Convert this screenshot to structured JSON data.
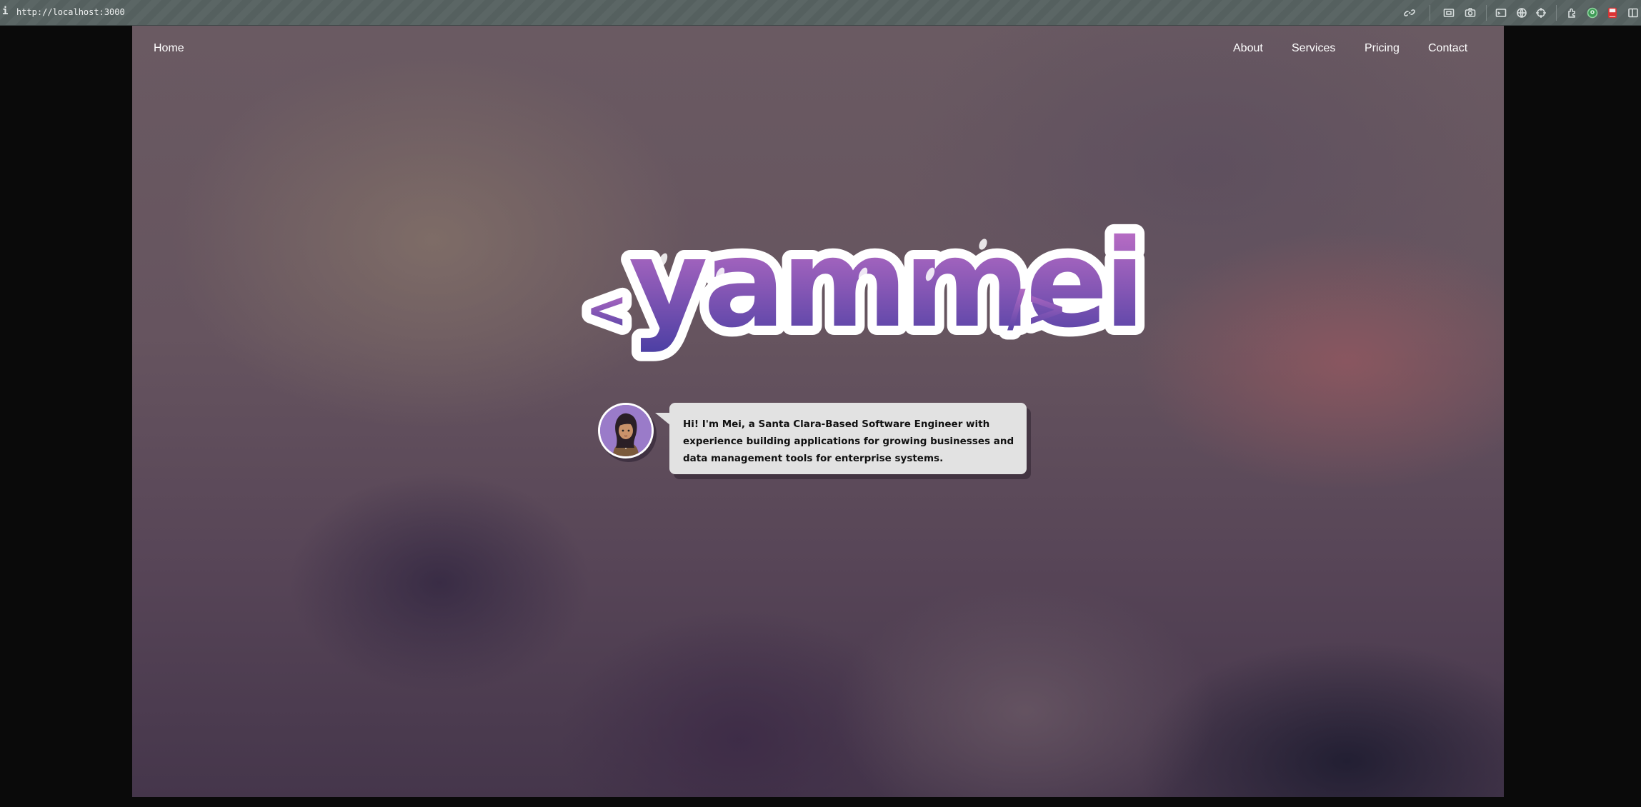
{
  "browser": {
    "info_glyph": "i",
    "url": "http://localhost:3000",
    "toolbar_icons": [
      "link-icon",
      "screenshot-icon",
      "camera-icon",
      "terminal-icon",
      "globe-icon",
      "crosshair-icon",
      "extensions-icon",
      "profile-icon",
      "pdf-icon",
      "sidebar-icon"
    ]
  },
  "nav": {
    "home": "Home",
    "links": [
      "About",
      "Services",
      "Pricing",
      "Contact"
    ]
  },
  "hero": {
    "logo_text": "yammei",
    "logo_open": "<",
    "logo_close": "/>",
    "intro_text": "Hi! I'm Mei, a Santa Clara-Based Software Engineer with experience building applications for growing businesses and data management tools for enterprise systems."
  },
  "colors": {
    "logo_top": "#c873c9",
    "logo_bottom": "#4a3ea3",
    "bubble": "#e2e2e2",
    "avatar_bg": "#9a7bc9"
  }
}
